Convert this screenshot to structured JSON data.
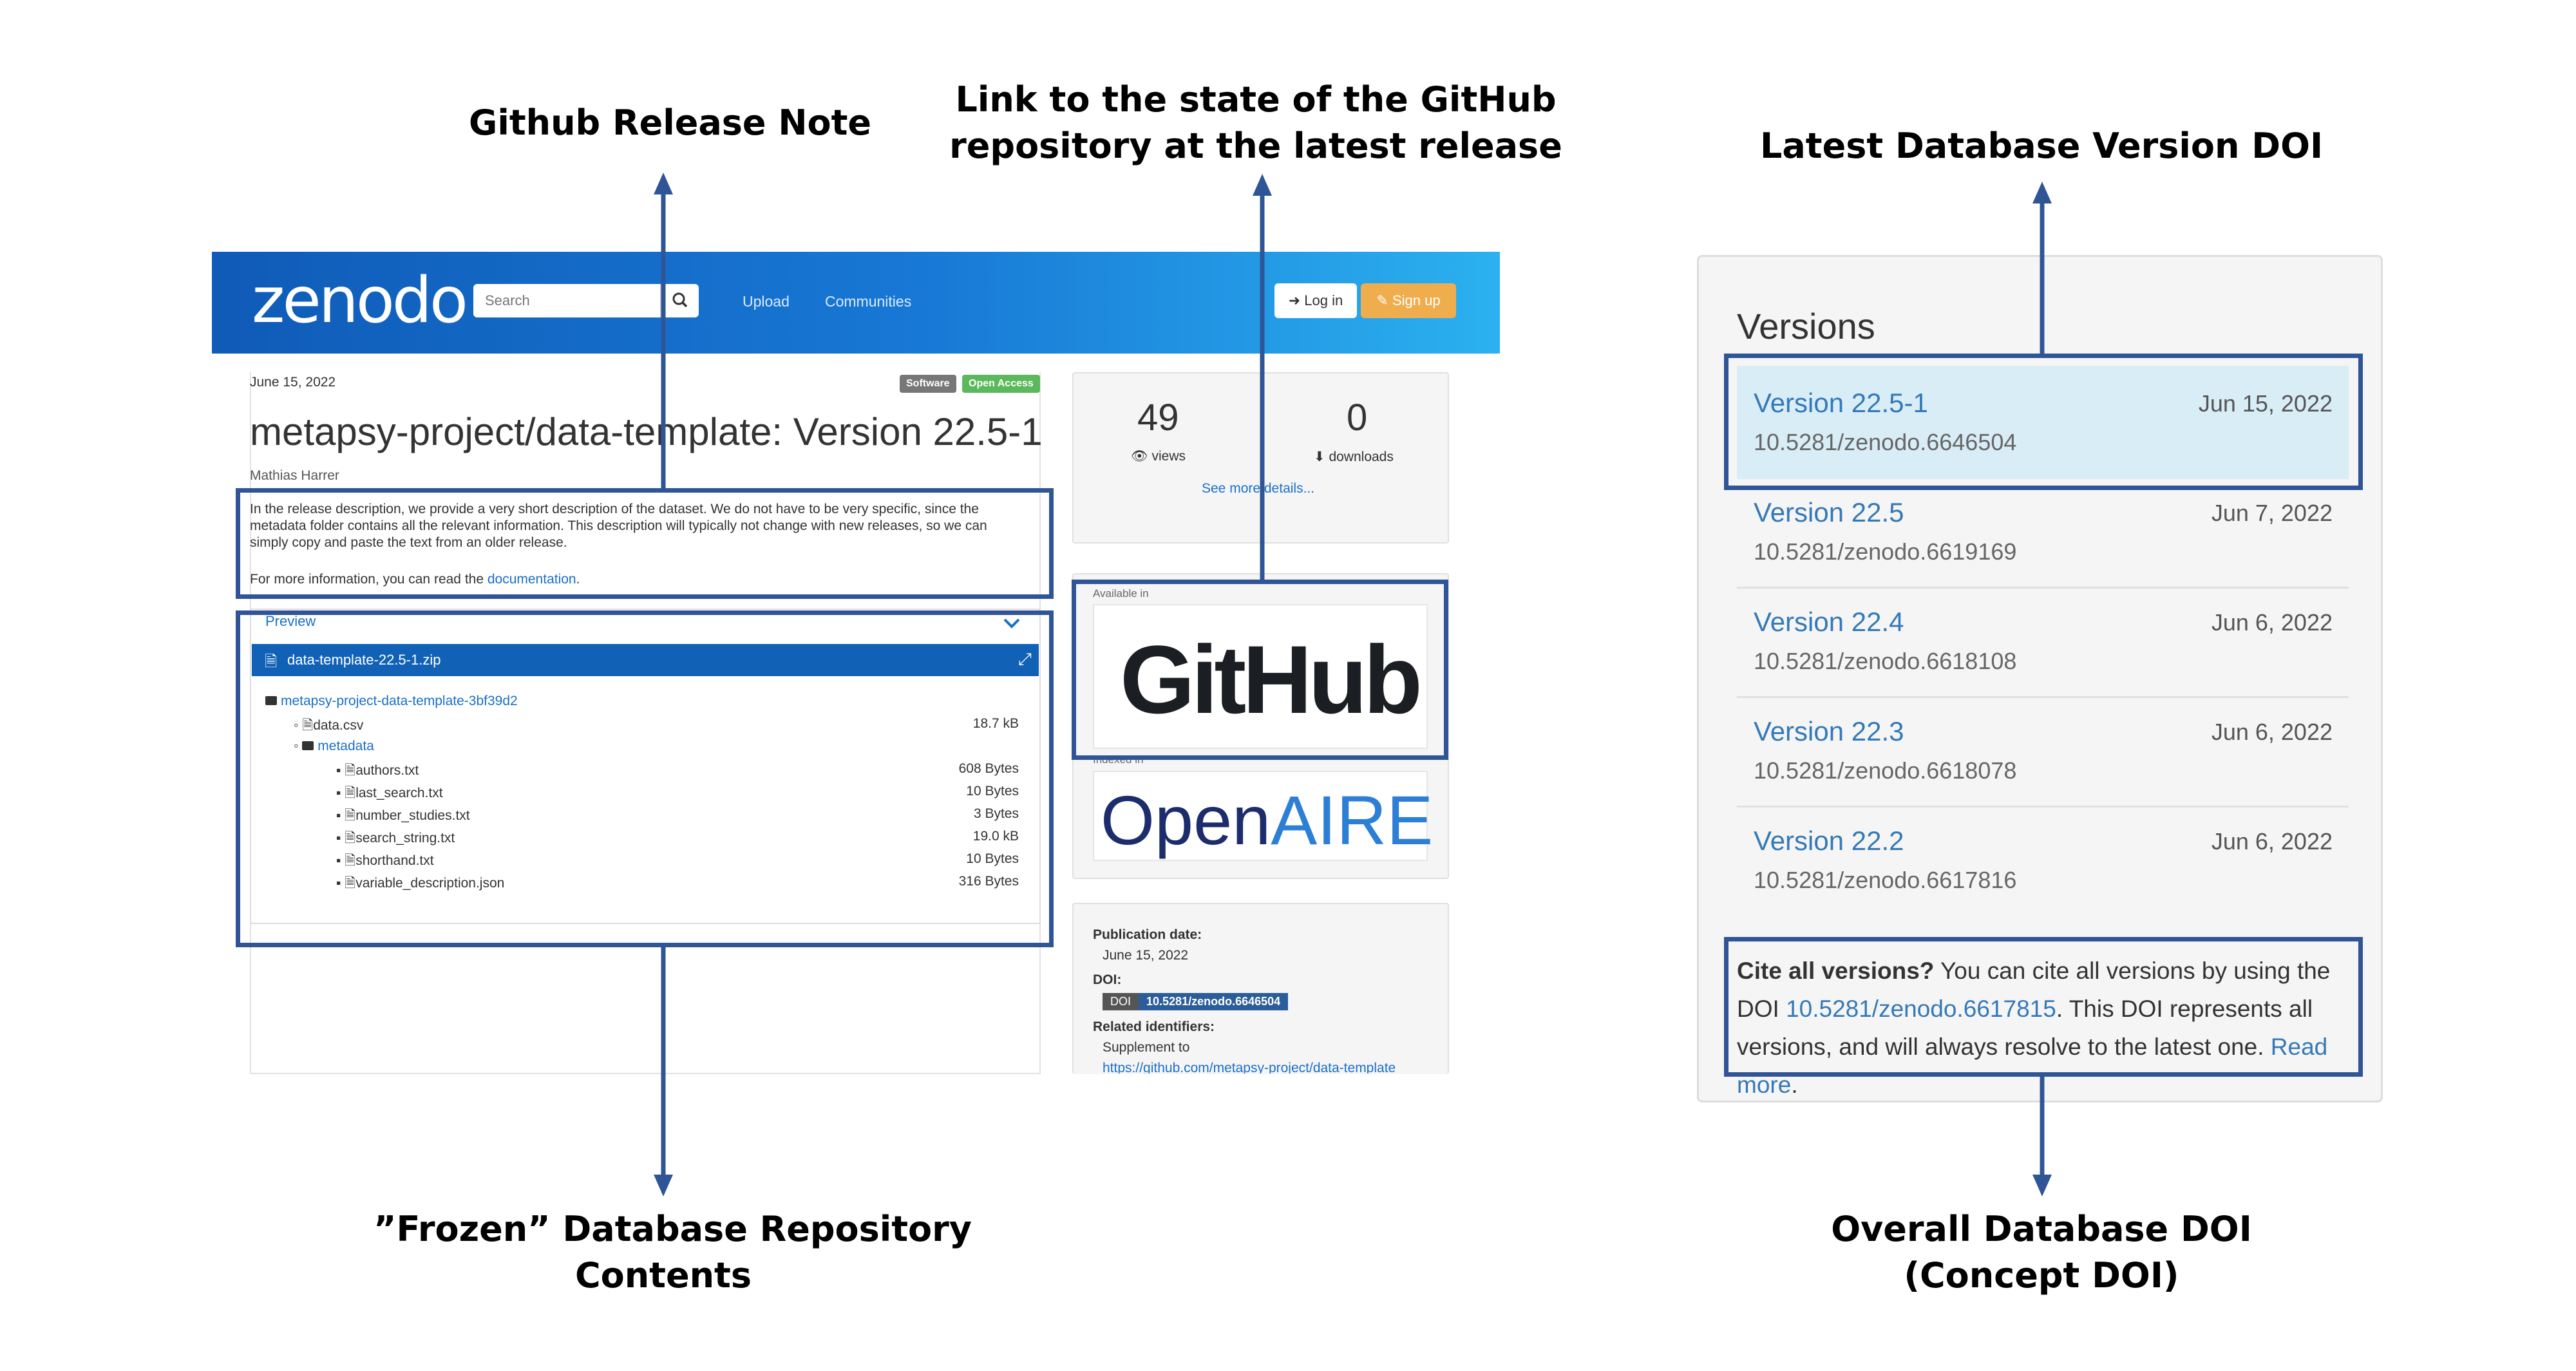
{
  "colors": {
    "annotation": "#2f5597",
    "zenodo_blue": "#1162b7",
    "link": "#1a6fc9",
    "signup": "#f0ad4e",
    "software_badge": "#777777",
    "open_access_badge": "#5cb85c",
    "doi_badge": "#2a5d99"
  },
  "callouts": {
    "release_note": "Github Release Note",
    "github_link_line1": "Link to the state of the GitHub",
    "github_link_line2": "repository at the latest release",
    "latest_doi": "Latest Database Version DOI",
    "frozen_line1": "”Frozen” Database Repository",
    "frozen_line2": "Contents",
    "concept_line1": "Overall Database DOI",
    "concept_line2": "(Concept DOI)"
  },
  "header": {
    "logo": "zenodo",
    "search_placeholder": "Search",
    "upload": "Upload",
    "communities": "Communities",
    "login": "Log in",
    "signup": "Sign up"
  },
  "record": {
    "date": "June 15, 2022",
    "badge_software": "Software",
    "badge_open": "Open Access",
    "title": "metapsy-project/data-template: Version 22.5-1",
    "author": "Mathias Harrer",
    "description": "In the release description, we provide a very short description of the dataset. We do not have to be very specific, since the metadata folder contains all the relevant information. This description will typically not change with new releases, so we can simply copy and paste the text from an older release.",
    "more_prefix": "For more information, you can read the ",
    "more_link": "documentation",
    "more_suffix": "."
  },
  "preview": {
    "label": "Preview",
    "zip": "data-template-22.5-1.zip",
    "root": "metapsy-project-data-template-3bf39d2",
    "files": [
      {
        "name": "data.csv",
        "size": "18.7 kB"
      },
      {
        "name": "metadata",
        "size": ""
      },
      {
        "name": "authors.txt",
        "size": "608 Bytes"
      },
      {
        "name": "last_search.txt",
        "size": "10 Bytes"
      },
      {
        "name": "number_studies.txt",
        "size": "3 Bytes"
      },
      {
        "name": "search_string.txt",
        "size": "19.0 kB"
      },
      {
        "name": "shorthand.txt",
        "size": "10 Bytes"
      },
      {
        "name": "variable_description.json",
        "size": "316 Bytes"
      }
    ]
  },
  "stats": {
    "views_count": "49",
    "views_label": "views",
    "downloads_count": "0",
    "downloads_label": "downloads",
    "details_link": "See more details..."
  },
  "integrations": {
    "available_in": "Available in",
    "github": "GitHub",
    "indexed_in": "Indexed in",
    "openaire_open": "Open",
    "openaire_aire": "AIRE"
  },
  "metadata": {
    "pub_date_label": "Publication date:",
    "pub_date": "June 15, 2022",
    "doi_label": "DOI:",
    "doi_badge_left": "DOI",
    "doi_badge_right": "10.5281/zenodo.6646504",
    "related_label": "Related identifiers:",
    "supplement": "Supplement to",
    "related_url": "https://github.com/metapsy-project/data-template"
  },
  "versions": {
    "title": "Versions",
    "items": [
      {
        "name": "Version 22.5-1",
        "date": "Jun 15, 2022",
        "doi": "10.5281/zenodo.6646504"
      },
      {
        "name": "Version 22.5",
        "date": "Jun 7, 2022",
        "doi": "10.5281/zenodo.6619169"
      },
      {
        "name": "Version 22.4",
        "date": "Jun 6, 2022",
        "doi": "10.5281/zenodo.6618108"
      },
      {
        "name": "Version 22.3",
        "date": "Jun 6, 2022",
        "doi": "10.5281/zenodo.6618078"
      },
      {
        "name": "Version 22.2",
        "date": "Jun 6, 2022",
        "doi": "10.5281/zenodo.6617816"
      }
    ],
    "cite_bold": "Cite all versions?",
    "cite_text1": " You can cite all versions by using the DOI ",
    "cite_doi": "10.5281/zenodo.6617815",
    "cite_text2": ". This DOI represents all versions, and will always resolve to the latest one. ",
    "read_more": "Read more",
    "cite_end": "."
  }
}
